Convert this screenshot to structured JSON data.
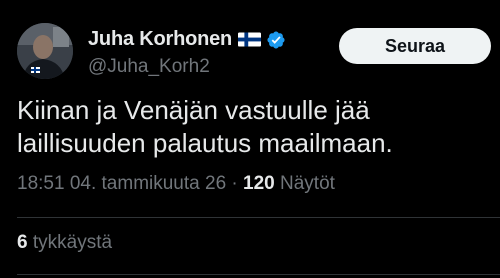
{
  "author": {
    "display_name": "Juha Korhonen",
    "flag_icon": "finland-flag-icon",
    "verified_icon": "verified-badge-icon",
    "handle": "@Juha_Korh2"
  },
  "follow_button": {
    "label": "Seuraa"
  },
  "tweet": {
    "text": "Kiinan ja Venäjän vastuulle jää laillisuuden palautus maailmaan."
  },
  "meta": {
    "time": "18:51",
    "date": "04. tammikuuta 26",
    "separator": "·",
    "views_count": "120",
    "views_label": "Näytöt"
  },
  "engagement": {
    "likes_count": "6",
    "likes_label": "tykkäystä"
  },
  "colors": {
    "background": "#000000",
    "text_primary": "#e7e9ea",
    "text_secondary": "#71767b",
    "verified_blue": "#1d9bf0",
    "flag_blue": "#003580",
    "button_bg": "#eff3f4",
    "divider": "#2f3336"
  }
}
